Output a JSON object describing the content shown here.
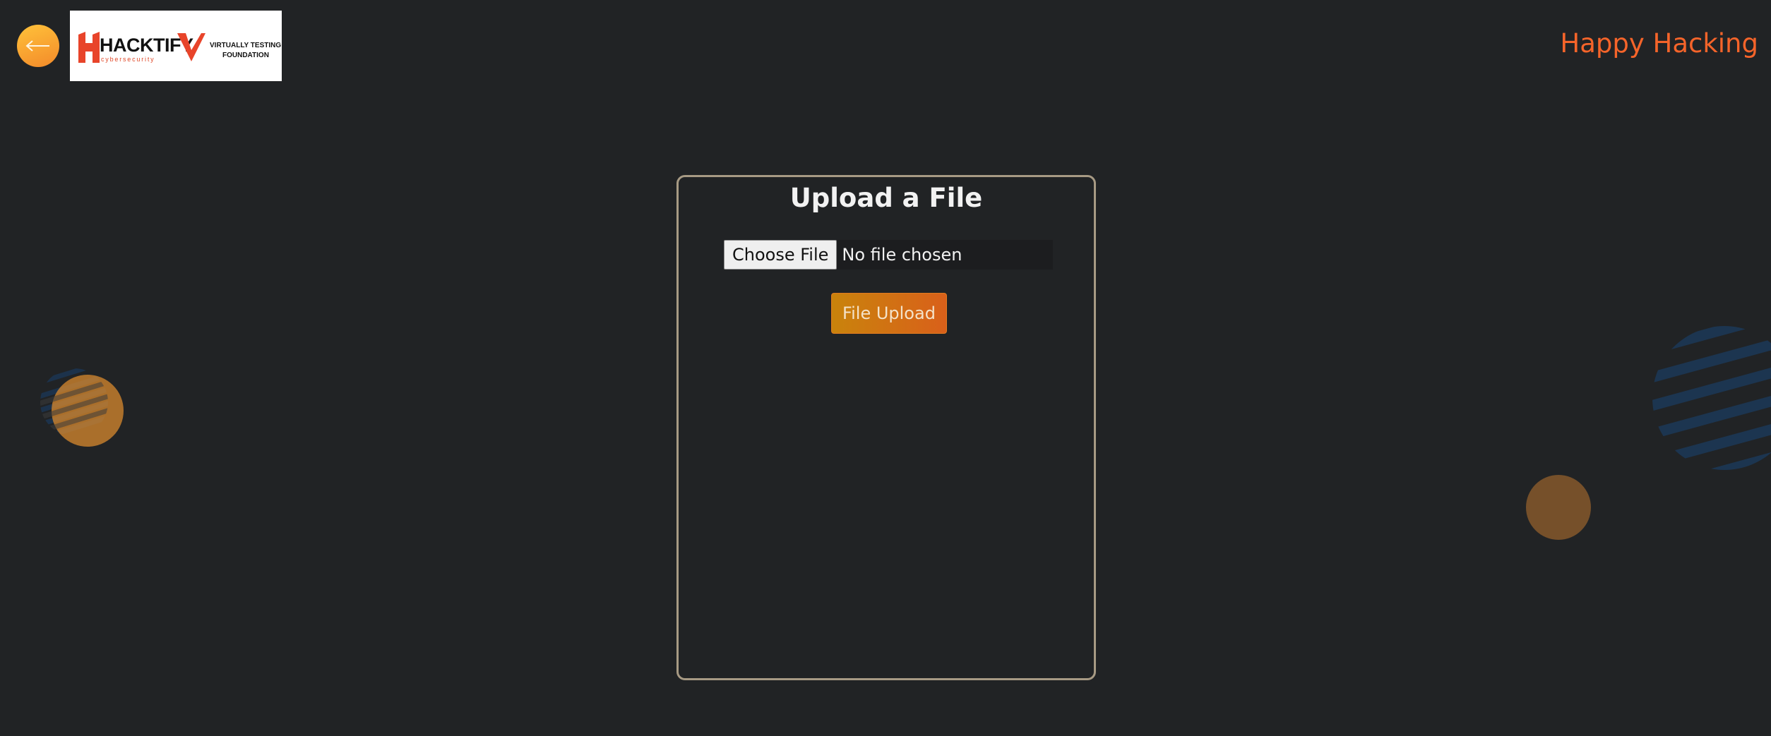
{
  "header": {
    "back_icon": "arrow-left-icon",
    "logo": {
      "brand_primary": "HACKTIFY",
      "brand_primary_sub": "cybersecurity",
      "brand_secondary_line1": "VIRTUALLY TESTING",
      "brand_secondary_line2": "FOUNDATION"
    },
    "tagline": "Happy Hacking"
  },
  "upload": {
    "title": "Upload a File",
    "choose_label": "Choose File",
    "file_status": "No file chosen",
    "submit_label": "File Upload"
  },
  "colors": {
    "background": "#212325",
    "accent_orange": "#f5642a",
    "card_border": "#a79a84",
    "button_gradient_start": "#c9830c",
    "button_gradient_end": "#d9601a"
  }
}
